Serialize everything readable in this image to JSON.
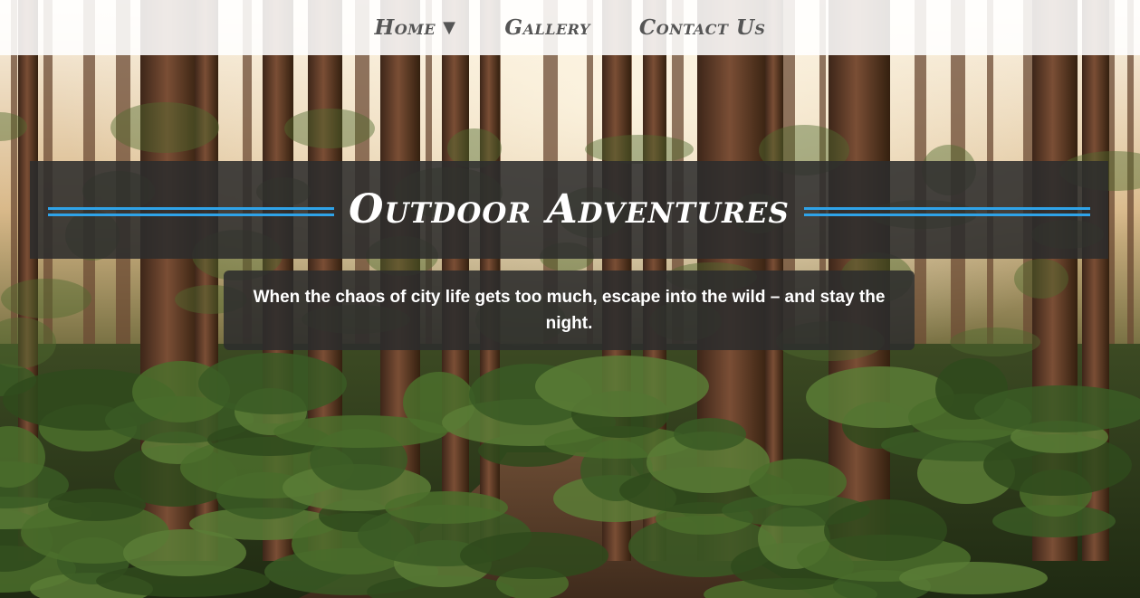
{
  "nav": {
    "items": [
      {
        "label": "Home",
        "has_dropdown": true,
        "caret": "▼"
      },
      {
        "label": "Gallery",
        "has_dropdown": false
      },
      {
        "label": "Contact Us",
        "has_dropdown": false
      }
    ]
  },
  "hero": {
    "title": "Outdoor Adventures",
    "tagline": "When the chaos of city life gets too much, escape into the wild – and stay the night."
  },
  "background": {
    "icon": "forest-photo",
    "description_colors": {
      "sky": "#f6efe2",
      "trunks": "#5a3a28",
      "foliage": "#3f5a2a",
      "path": "#4a3524"
    }
  },
  "colors": {
    "accent": "#2fa3e8",
    "nav_bg": "#ffffff",
    "nav_text": "#555555",
    "panel_bg": "#2c2c2c",
    "panel_text": "#ffffff"
  }
}
